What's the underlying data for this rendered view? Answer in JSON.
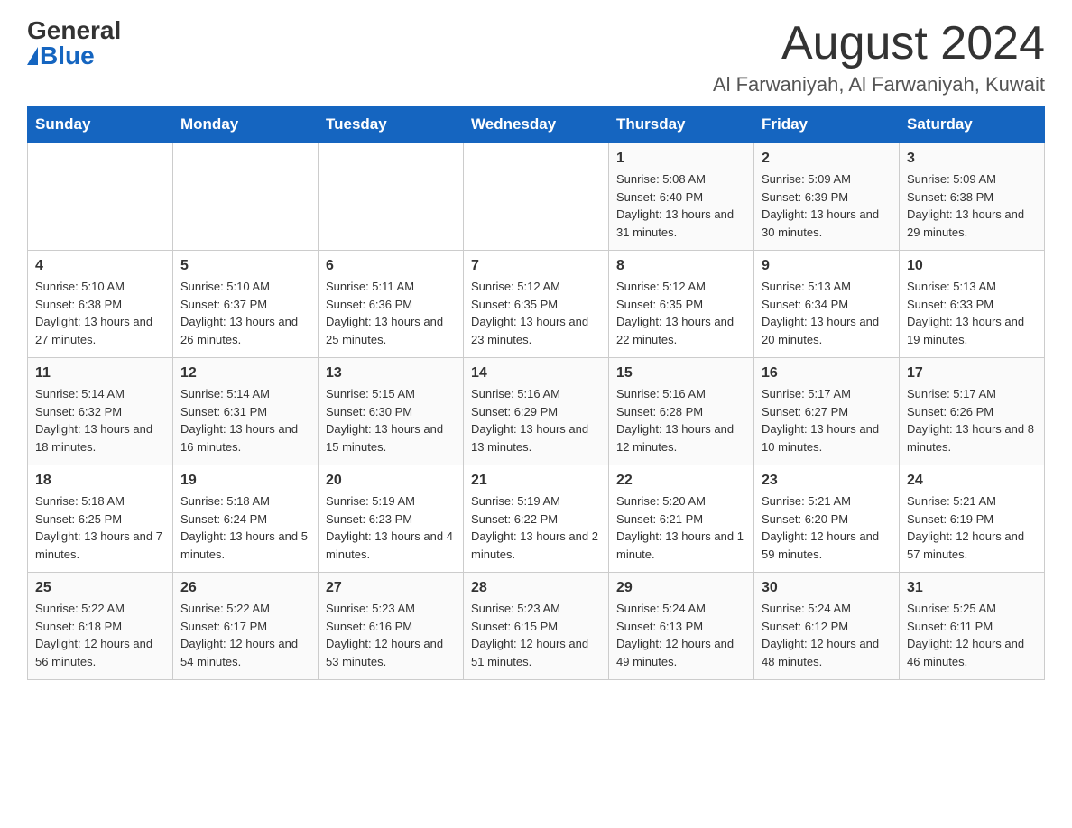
{
  "header": {
    "logo_general": "General",
    "logo_blue": "Blue",
    "month_title": "August 2024",
    "location": "Al Farwaniyah, Al Farwaniyah, Kuwait"
  },
  "weekdays": [
    "Sunday",
    "Monday",
    "Tuesday",
    "Wednesday",
    "Thursday",
    "Friday",
    "Saturday"
  ],
  "weeks": [
    [
      {
        "day": "",
        "info": ""
      },
      {
        "day": "",
        "info": ""
      },
      {
        "day": "",
        "info": ""
      },
      {
        "day": "",
        "info": ""
      },
      {
        "day": "1",
        "info": "Sunrise: 5:08 AM\nSunset: 6:40 PM\nDaylight: 13 hours and 31 minutes."
      },
      {
        "day": "2",
        "info": "Sunrise: 5:09 AM\nSunset: 6:39 PM\nDaylight: 13 hours and 30 minutes."
      },
      {
        "day": "3",
        "info": "Sunrise: 5:09 AM\nSunset: 6:38 PM\nDaylight: 13 hours and 29 minutes."
      }
    ],
    [
      {
        "day": "4",
        "info": "Sunrise: 5:10 AM\nSunset: 6:38 PM\nDaylight: 13 hours and 27 minutes."
      },
      {
        "day": "5",
        "info": "Sunrise: 5:10 AM\nSunset: 6:37 PM\nDaylight: 13 hours and 26 minutes."
      },
      {
        "day": "6",
        "info": "Sunrise: 5:11 AM\nSunset: 6:36 PM\nDaylight: 13 hours and 25 minutes."
      },
      {
        "day": "7",
        "info": "Sunrise: 5:12 AM\nSunset: 6:35 PM\nDaylight: 13 hours and 23 minutes."
      },
      {
        "day": "8",
        "info": "Sunrise: 5:12 AM\nSunset: 6:35 PM\nDaylight: 13 hours and 22 minutes."
      },
      {
        "day": "9",
        "info": "Sunrise: 5:13 AM\nSunset: 6:34 PM\nDaylight: 13 hours and 20 minutes."
      },
      {
        "day": "10",
        "info": "Sunrise: 5:13 AM\nSunset: 6:33 PM\nDaylight: 13 hours and 19 minutes."
      }
    ],
    [
      {
        "day": "11",
        "info": "Sunrise: 5:14 AM\nSunset: 6:32 PM\nDaylight: 13 hours and 18 minutes."
      },
      {
        "day": "12",
        "info": "Sunrise: 5:14 AM\nSunset: 6:31 PM\nDaylight: 13 hours and 16 minutes."
      },
      {
        "day": "13",
        "info": "Sunrise: 5:15 AM\nSunset: 6:30 PM\nDaylight: 13 hours and 15 minutes."
      },
      {
        "day": "14",
        "info": "Sunrise: 5:16 AM\nSunset: 6:29 PM\nDaylight: 13 hours and 13 minutes."
      },
      {
        "day": "15",
        "info": "Sunrise: 5:16 AM\nSunset: 6:28 PM\nDaylight: 13 hours and 12 minutes."
      },
      {
        "day": "16",
        "info": "Sunrise: 5:17 AM\nSunset: 6:27 PM\nDaylight: 13 hours and 10 minutes."
      },
      {
        "day": "17",
        "info": "Sunrise: 5:17 AM\nSunset: 6:26 PM\nDaylight: 13 hours and 8 minutes."
      }
    ],
    [
      {
        "day": "18",
        "info": "Sunrise: 5:18 AM\nSunset: 6:25 PM\nDaylight: 13 hours and 7 minutes."
      },
      {
        "day": "19",
        "info": "Sunrise: 5:18 AM\nSunset: 6:24 PM\nDaylight: 13 hours and 5 minutes."
      },
      {
        "day": "20",
        "info": "Sunrise: 5:19 AM\nSunset: 6:23 PM\nDaylight: 13 hours and 4 minutes."
      },
      {
        "day": "21",
        "info": "Sunrise: 5:19 AM\nSunset: 6:22 PM\nDaylight: 13 hours and 2 minutes."
      },
      {
        "day": "22",
        "info": "Sunrise: 5:20 AM\nSunset: 6:21 PM\nDaylight: 13 hours and 1 minute."
      },
      {
        "day": "23",
        "info": "Sunrise: 5:21 AM\nSunset: 6:20 PM\nDaylight: 12 hours and 59 minutes."
      },
      {
        "day": "24",
        "info": "Sunrise: 5:21 AM\nSunset: 6:19 PM\nDaylight: 12 hours and 57 minutes."
      }
    ],
    [
      {
        "day": "25",
        "info": "Sunrise: 5:22 AM\nSunset: 6:18 PM\nDaylight: 12 hours and 56 minutes."
      },
      {
        "day": "26",
        "info": "Sunrise: 5:22 AM\nSunset: 6:17 PM\nDaylight: 12 hours and 54 minutes."
      },
      {
        "day": "27",
        "info": "Sunrise: 5:23 AM\nSunset: 6:16 PM\nDaylight: 12 hours and 53 minutes."
      },
      {
        "day": "28",
        "info": "Sunrise: 5:23 AM\nSunset: 6:15 PM\nDaylight: 12 hours and 51 minutes."
      },
      {
        "day": "29",
        "info": "Sunrise: 5:24 AM\nSunset: 6:13 PM\nDaylight: 12 hours and 49 minutes."
      },
      {
        "day": "30",
        "info": "Sunrise: 5:24 AM\nSunset: 6:12 PM\nDaylight: 12 hours and 48 minutes."
      },
      {
        "day": "31",
        "info": "Sunrise: 5:25 AM\nSunset: 6:11 PM\nDaylight: 12 hours and 46 minutes."
      }
    ]
  ]
}
